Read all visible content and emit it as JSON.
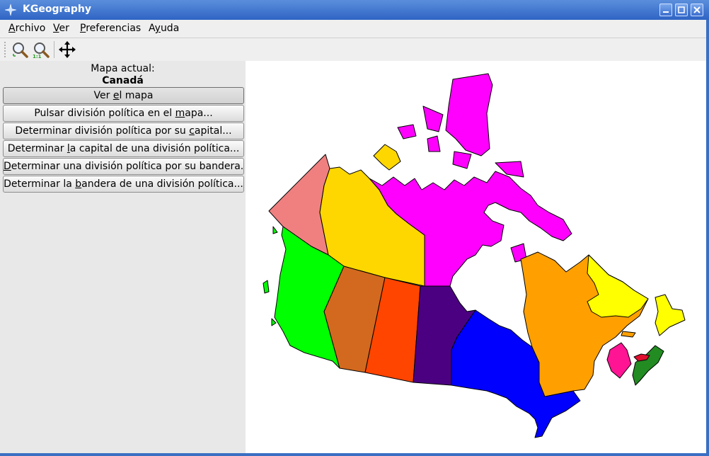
{
  "window": {
    "title": "KGeography"
  },
  "menu": {
    "items": [
      {
        "pre": "",
        "u": "A",
        "post": "rchivo"
      },
      {
        "pre": "",
        "u": "V",
        "post": "er"
      },
      {
        "pre": "",
        "u": "P",
        "post": "referencias"
      },
      {
        "pre": "A",
        "u": "y",
        "post": "uda"
      }
    ]
  },
  "toolbar": {
    "icons": [
      "zoom-in-icon",
      "zoom-original-icon",
      "move-icon"
    ]
  },
  "sidebar": {
    "map_label": "Mapa actual:",
    "map_name": "Canadá",
    "buttons": [
      {
        "pre": "Ver ",
        "u": "e",
        "post": "l mapa"
      },
      {
        "pre": "Pulsar división política en el ",
        "u": "m",
        "post": "apa..."
      },
      {
        "pre": "Determinar división política por su ",
        "u": "c",
        "post": "apital..."
      },
      {
        "pre": "Determinar ",
        "u": "l",
        "post": "a capital de una división política..."
      },
      {
        "pre": "",
        "u": "D",
        "post": "eterminar una división política por su bandera..."
      },
      {
        "pre": "Determinar la ",
        "u": "b",
        "post": "andera de una división política..."
      }
    ]
  },
  "map": {
    "regions": [
      {
        "name": "Yukon",
        "color": "#f08080"
      },
      {
        "name": "Northwest Territories",
        "color": "#ffd700"
      },
      {
        "name": "Nunavut",
        "color": "#ff00ff"
      },
      {
        "name": "British Columbia",
        "color": "#00ff00"
      },
      {
        "name": "Alberta",
        "color": "#d2691e"
      },
      {
        "name": "Saskatchewan",
        "color": "#ff4500"
      },
      {
        "name": "Manitoba",
        "color": "#4b0082"
      },
      {
        "name": "Ontario",
        "color": "#0000ff"
      },
      {
        "name": "Quebec",
        "color": "#ffa000"
      },
      {
        "name": "Newfoundland and Labrador",
        "color": "#ffff00"
      },
      {
        "name": "New Brunswick",
        "color": "#ff1493"
      },
      {
        "name": "Nova Scotia",
        "color": "#228b22"
      },
      {
        "name": "Prince Edward Island",
        "color": "#e01030"
      }
    ]
  }
}
